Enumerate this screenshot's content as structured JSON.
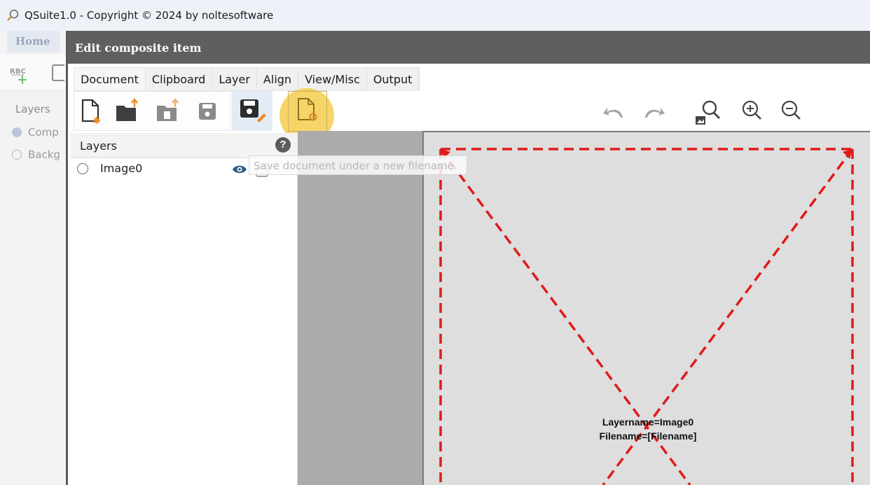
{
  "app": {
    "title": "QSuite1.0 - Copyright © 2024 by noltesoftware"
  },
  "background_app": {
    "home_tab": "Home",
    "layers_label": "Layers",
    "layer_items": [
      {
        "label": "Comp",
        "selected": true
      },
      {
        "label": "Backg",
        "selected": false
      }
    ]
  },
  "dialog": {
    "title": "Edit composite item",
    "menu_tabs": [
      "Document",
      "Clipboard",
      "Layer",
      "Align",
      "View/Misc",
      "Output"
    ],
    "active_tab": "Document",
    "toolbar_icons": [
      "new-document-icon",
      "open-folder-icon",
      "import-icon",
      "save-icon",
      "save-as-icon",
      "document-settings-icon"
    ],
    "view_icons": [
      "undo-icon",
      "redo-icon",
      "zoom-fit-icon",
      "zoom-in-icon",
      "zoom-out-icon"
    ],
    "tooltip": "Save document under a new filename",
    "layer_panel": {
      "title": "Layers",
      "help": "?",
      "layers": [
        {
          "name": "Image0",
          "visible": true,
          "locked": false
        }
      ]
    },
    "canvas": {
      "caption_line1": "Layername=Image0",
      "caption_line2": "Filename=[Filename]"
    }
  },
  "colors": {
    "dialog_titlebar": "#5f5f5f",
    "highlight": "#f5c83c",
    "placeholder_dash": "#e01a1a",
    "canvas_bg": "#ababab"
  }
}
